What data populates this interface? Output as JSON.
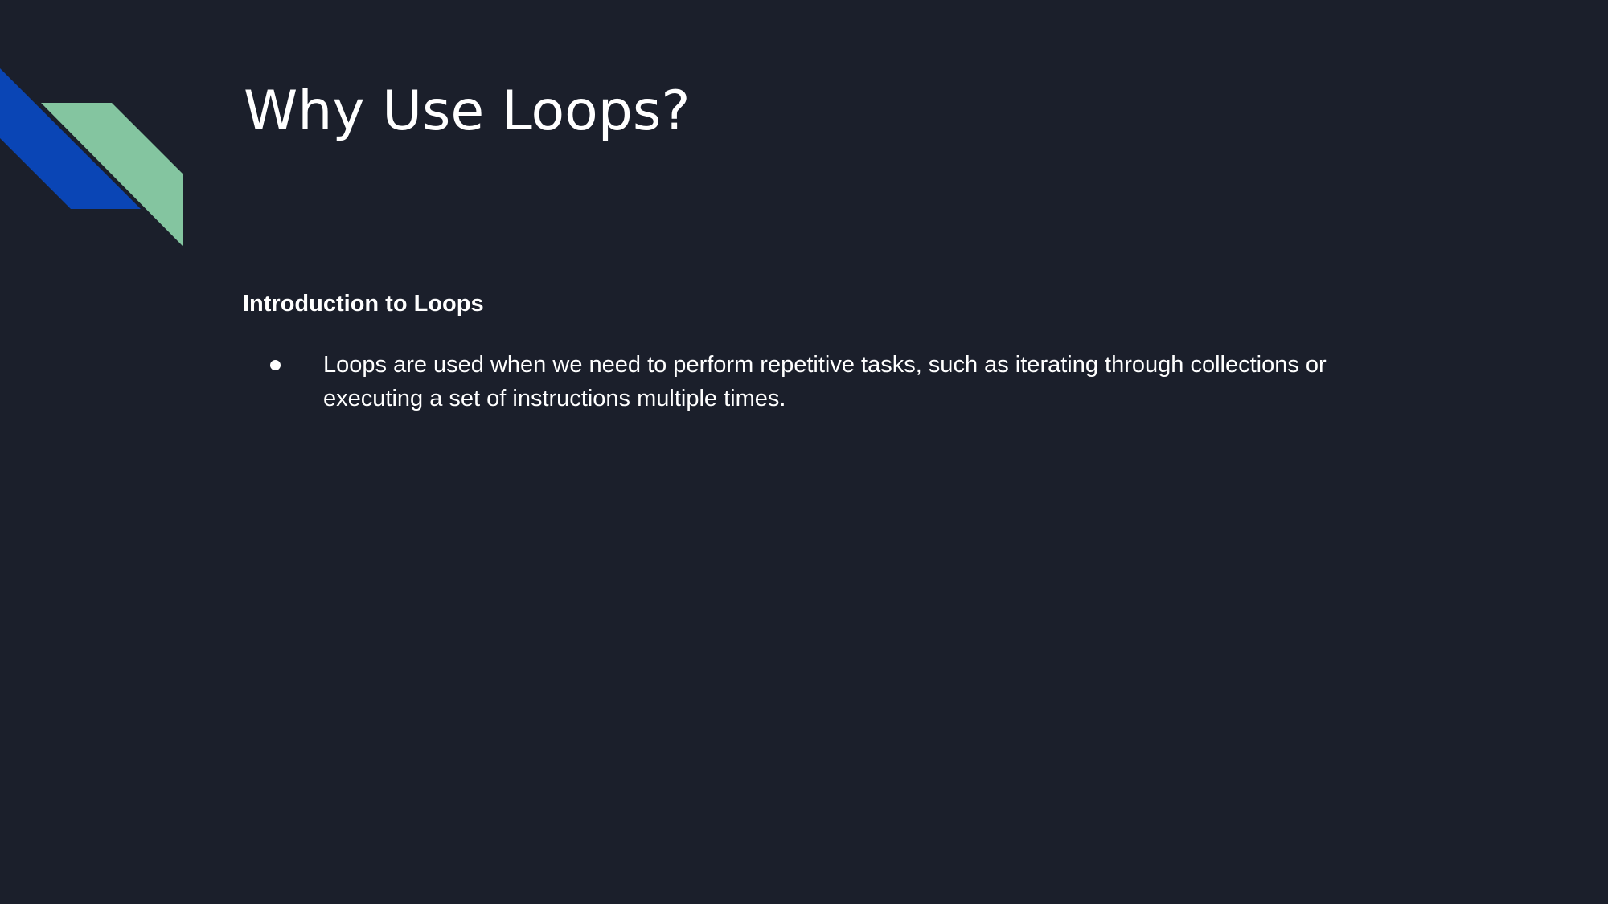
{
  "slide": {
    "title": "Why Use Loops?",
    "subheading": "Introduction to Loops",
    "bullets": [
      {
        "text": "Loops are used when we need to perform repetitive tasks, such as iterating through collections or executing a set of instructions multiple times."
      }
    ]
  },
  "decoration": {
    "blue": "#0a45b5",
    "green": "#84c5a0",
    "background": "#1b1f2b"
  }
}
